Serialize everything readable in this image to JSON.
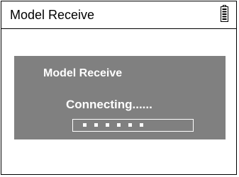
{
  "header": {
    "title": "Model Receive",
    "battery_icon": "battery-full-icon"
  },
  "dialog": {
    "title": "Model Receive",
    "status": "Connecting......",
    "progress": {
      "segments_filled": 6
    }
  },
  "colors": {
    "dialog_bg": "#808080",
    "text_light": "#ffffff",
    "border": "#000000"
  }
}
